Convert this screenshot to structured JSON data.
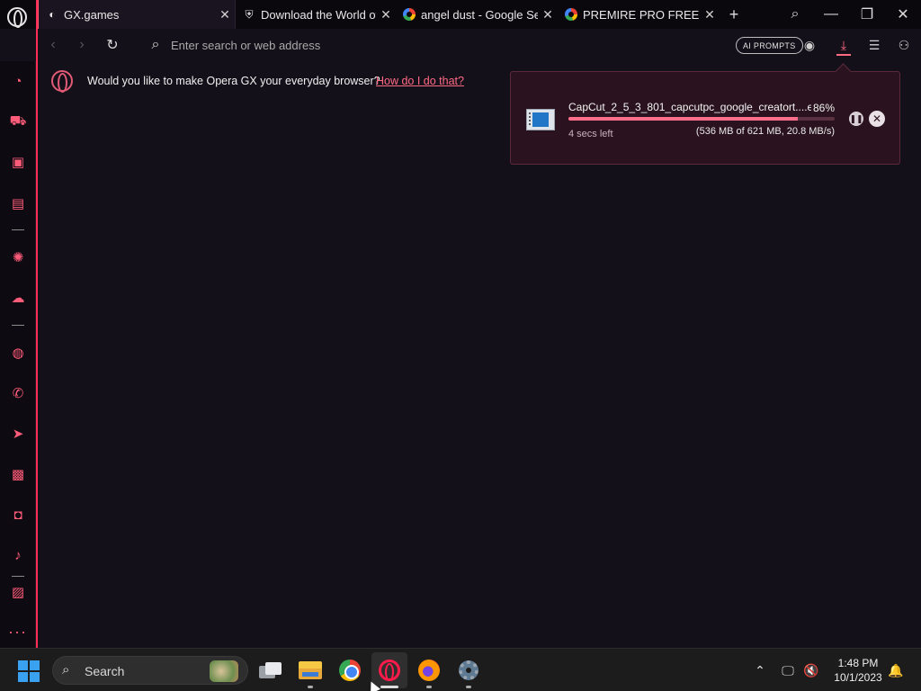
{
  "tabs": [
    {
      "title": "GX.games",
      "favicon": "gx-games-icon",
      "active": true
    },
    {
      "title": "Download the World of",
      "favicon": "world-of-tanks-icon",
      "active": false
    },
    {
      "title": "angel dust - Google Sea",
      "favicon": "google-icon",
      "active": false
    },
    {
      "title": "PREMIRE PRO FREE - Go",
      "favicon": "google-icon",
      "active": false
    }
  ],
  "addressbar": {
    "placeholder": "Enter search or web address",
    "ai_prompts_label": "AI PROMPTS"
  },
  "prompt": {
    "text": "Would you like to make Opera GX your everyday browser?",
    "link": "How do I do that?"
  },
  "download": {
    "filename": "CapCut_2_5_3_801_capcutpc_google_creatort....e...",
    "percent_label": "86%",
    "progress": 0.86,
    "time_left": "4 secs left",
    "size_info": "(536 MB of 621 MB, 20.8 MB/s)"
  },
  "sidebar": {
    "items": [
      "gx-corner-icon",
      "shopping-bag-icon",
      "twitch-icon",
      "gx-control-icon",
      "chatgpt-icon",
      "chatsonic-icon",
      "messenger-icon",
      "whatsapp-icon",
      "telegram-icon",
      "vk-icon",
      "instagram-icon",
      "tiktok-icon",
      "gallery-icon",
      "more-icon"
    ]
  },
  "taskbar": {
    "search_label": "Search",
    "time": "1:48 PM",
    "date": "10/1/2023"
  },
  "colors": {
    "accent": "#ff2d55",
    "background": "#141019",
    "download_popup": "#2a131e"
  }
}
